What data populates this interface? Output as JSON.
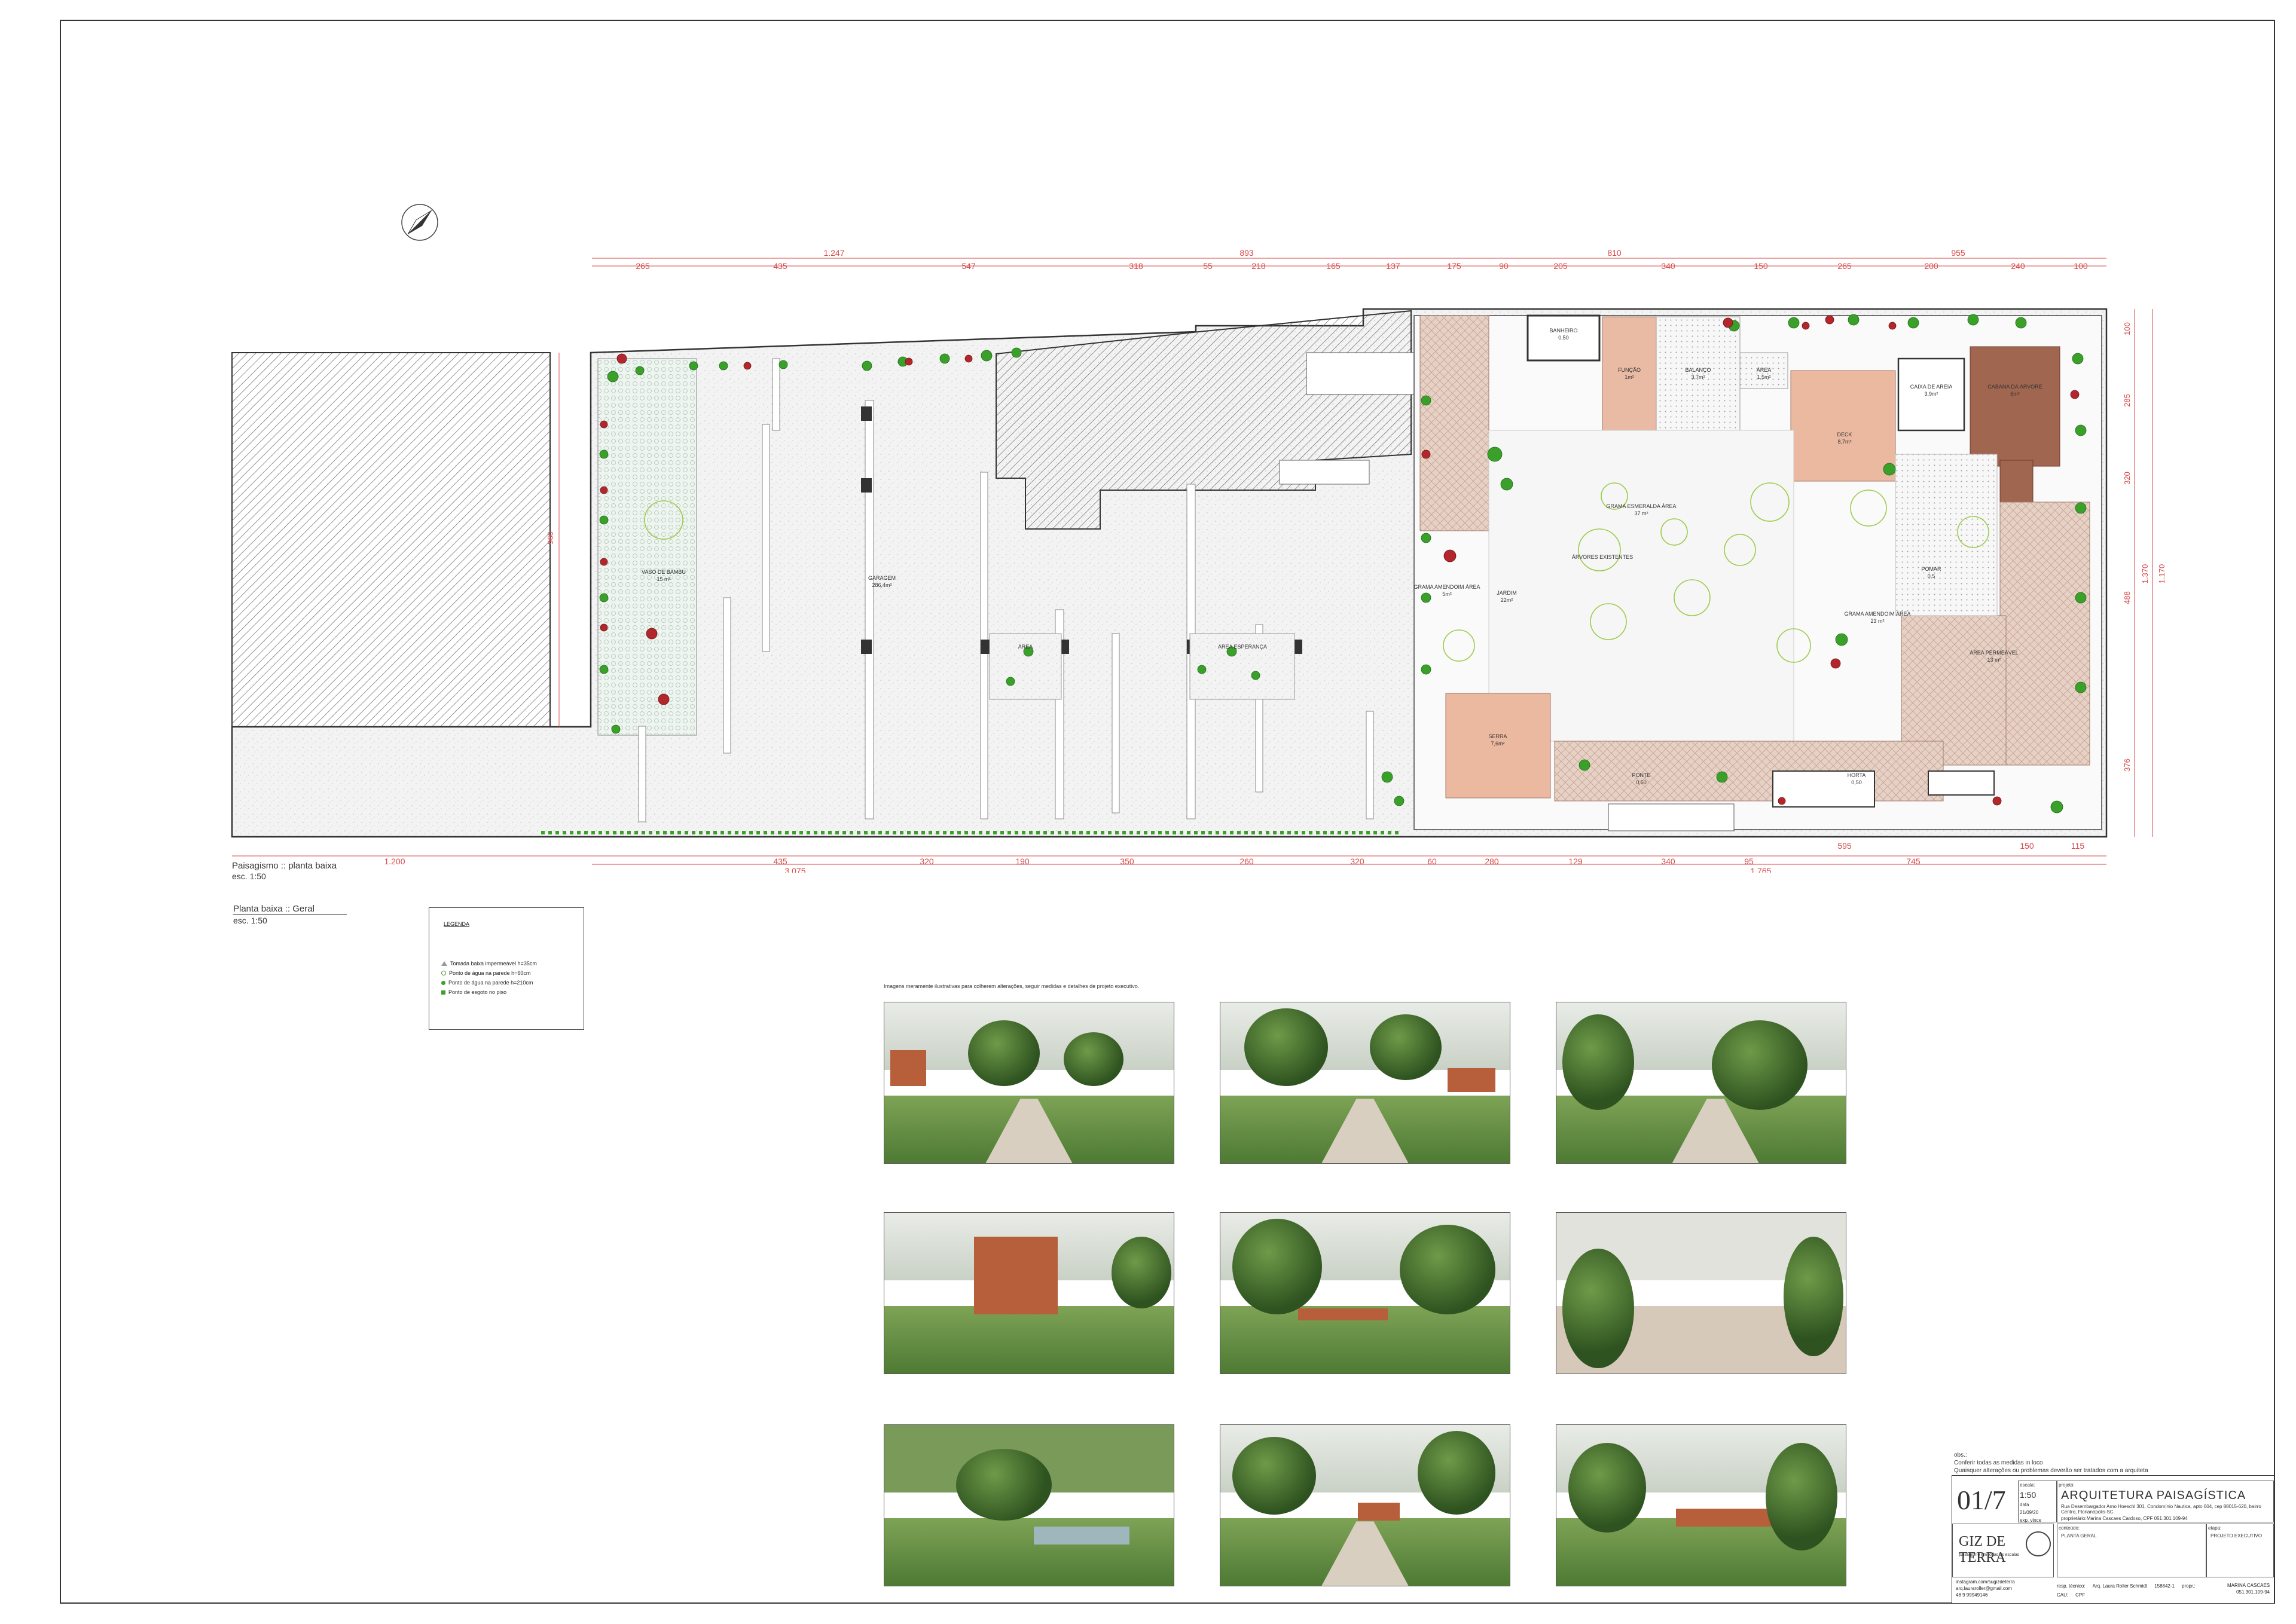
{
  "titles": {
    "paisagismo_title": "Paisagismo :: planta baixa",
    "paisagismo_scale": "esc. 1:50",
    "geral_title": "Planta baixa :: Geral",
    "geral_scale": "esc. 1:50"
  },
  "legend": {
    "title": "LEGENDA",
    "items": [
      {
        "label": "Tomada baixa impermeável h=35cm",
        "icon": "triangle-outline-icon"
      },
      {
        "label": "Ponto de água na parede h=60cm",
        "icon": "open-circle-icon"
      },
      {
        "label": "Ponto de água na parede h=210cm",
        "icon": "green-dot-icon"
      },
      {
        "label": "Ponto de esgoto no piso",
        "icon": "green-square-icon"
      }
    ]
  },
  "dimensions": {
    "top_total": [
      "1.247",
      "893",
      "810",
      "955"
    ],
    "top_segments": [
      "265",
      "435",
      "547",
      "318",
      "55",
      "218",
      "165",
      "137",
      "175",
      "90",
      "205",
      "340",
      "150",
      "265",
      "200",
      "240",
      "100"
    ],
    "bottom_segments": [
      "1.200",
      "435",
      "320",
      "190",
      "350",
      "260",
      "320",
      "60",
      "280",
      "129",
      "340",
      "95",
      "595",
      "745",
      "150",
      "115"
    ],
    "bottom_total": [
      "3.075",
      "1.765"
    ],
    "left": [
      "960"
    ],
    "right": [
      "100",
      "285",
      "320",
      "488",
      "376",
      "1.370",
      "1.170"
    ]
  },
  "areas": [
    {
      "name": "VASO DE BAMBU",
      "area": "15 m²"
    },
    {
      "name": "GARAGEM",
      "area": "286,4m²"
    },
    {
      "name": "ÁREA",
      "area": ""
    },
    {
      "name": "ÁREA ESPERANÇA",
      "area": ""
    },
    {
      "name": "BANHEIRO",
      "area": "0,50"
    },
    {
      "name": "FUNÇÃO",
      "area": "1m²"
    },
    {
      "name": "BALANÇO",
      "area": "3,7m²"
    },
    {
      "name": "ÁREA",
      "area": "1,5m²"
    },
    {
      "name": "DECK",
      "area": "8,7m²"
    },
    {
      "name": "CAIXA DE AREIA",
      "area": "3,9m²"
    },
    {
      "name": "CABANA DA ÁRVORE",
      "area": "6m²"
    },
    {
      "name": "GRAMA ESMERALDA ÁREA",
      "area": "37 m²"
    },
    {
      "name": "ÁRVORES EXISTENTES",
      "area": ""
    },
    {
      "name": "JARDIM",
      "area": "22m²"
    },
    {
      "name": "GRAMA AMENDOIM ÁREA",
      "area": "5m²"
    },
    {
      "name": "POMAR",
      "area": "0,5"
    },
    {
      "name": "GRAMA AMENDOIM ÁREA",
      "area": "23 m²"
    },
    {
      "name": "ÁREA PERMEÁVEL",
      "area": "13 m²"
    },
    {
      "name": "SERRA",
      "area": "7,6m²"
    },
    {
      "name": "PONTE",
      "area": "0,50"
    },
    {
      "name": "HORTA",
      "area": "0,50"
    }
  ],
  "renders_note": "Imagens meramente ilustrativas para colherem alterações, seguir medidas e detalhes de projeto executivo.",
  "renders": [
    "render-1",
    "render-2",
    "render-3",
    "render-4",
    "render-5",
    "render-6",
    "render-7",
    "render-8",
    "render-9"
  ],
  "notes": {
    "title": "obs.:",
    "lines": [
      "Conferir todas as medidas in loco",
      "Quaisquer alterações ou problemas deverão ser tratados com a arquiteta"
    ]
  },
  "title_block": {
    "sheet_number": "01/7",
    "scale_label": "escala:",
    "scale_value": "1:50",
    "date_label": "data",
    "date_value": "21/09/20",
    "exp_label": "exp. vince",
    "project_label": "projeto:",
    "firm_title": "ARQUITETURA PAISAGÍSTICA",
    "address": "Rua Desembargador Arno Hoeschl 301, Condomínio Nautica, apto 604, cep 88015-620, bairro Centro, Florianópolis-SC",
    "owner": "proprietário:Marina Cascaes Cardoso, CPF 051.301.109-94",
    "content_label": "conteúdo:",
    "content_value": "PLANTA GERAL",
    "stage_label": "etapa:",
    "stage_value": "PROJETO EXECUTIVO",
    "logo_text": "GIZ DE TERRA",
    "logo_tagline": "paisagismo em todas as escalas",
    "instagram": "instagram.com/sugizdeterra",
    "email": "arq.lauraroller@gmail.com",
    "phone": "48 9 99949146",
    "resp_label": "resp. técnico:",
    "resp_value": "Arq. Laura Roller Schmidt",
    "cau_label": "CAU:",
    "cau_value": "158842-1",
    "prop_label": "propr.:",
    "prop_value": "CPF",
    "client_name": "MARINA CASCAES",
    "client_cpf": "051.301.109-94"
  },
  "colors": {
    "dimension_red": "#d64a4a",
    "hatch": "#555555",
    "grass": "#f1f1f1",
    "plant_green": "#3aa02a",
    "plant_red": "#b3262b",
    "deck_salmon": "#e8b39a",
    "wood": "#a0604a"
  }
}
